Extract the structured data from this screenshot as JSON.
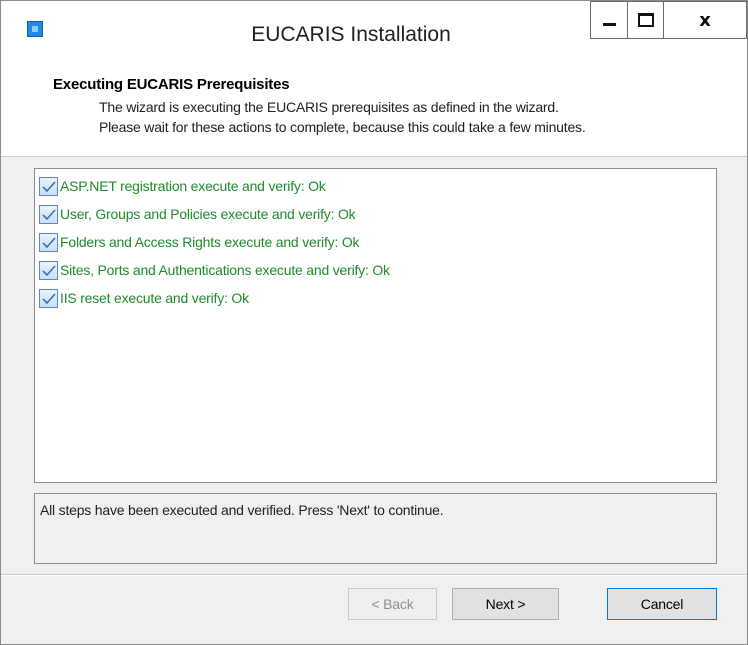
{
  "window": {
    "title": "EUCARIS Installation",
    "close_label": "x"
  },
  "header": {
    "title": "Executing EUCARIS Prerequisites",
    "description_line1": "The wizard is executing the EUCARIS prerequisites as defined in the wizard.",
    "description_line2": "Please wait for these actions to complete, because this could take a few minutes."
  },
  "steps": [
    {
      "label": "ASP.NET registration execute and verify: Ok",
      "checked": true
    },
    {
      "label": "User, Groups and Policies execute and verify: Ok",
      "checked": true
    },
    {
      "label": "Folders and Access Rights execute and verify: Ok",
      "checked": true
    },
    {
      "label": "Sites, Ports and Authentications execute and verify: Ok",
      "checked": true
    },
    {
      "label": "IIS reset execute and verify: Ok",
      "checked": true
    }
  ],
  "status": {
    "message": "All steps have been executed and verified. Press 'Next' to continue."
  },
  "buttons": {
    "back": "< Back",
    "next": "Next >",
    "cancel": "Cancel"
  },
  "colors": {
    "step_text": "#1e8b2a",
    "accent": "#0078d7",
    "app_icon": "#1e88e5"
  },
  "icons": {
    "app": "app-icon",
    "minimize": "minimize-icon",
    "maximize": "maximize-icon",
    "close": "close-icon",
    "step_status": "checkbox-checked-icon"
  }
}
